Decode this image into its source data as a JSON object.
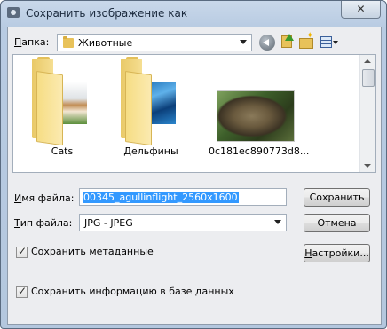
{
  "window": {
    "title": "Сохранить изображение как",
    "close": "✕"
  },
  "toolbar": {
    "folder_label": "Папка:",
    "folder_label_hotkey": "П",
    "folder_label_rest": "апка:",
    "folder_value": "Животные",
    "icons": [
      "back-icon",
      "up-folder-icon",
      "new-folder-icon",
      "view-menu-icon"
    ]
  },
  "files": [
    {
      "name": "Cats",
      "kind": "folder",
      "icon": "folder-icon"
    },
    {
      "name": "Дельфины",
      "kind": "folder",
      "icon": "folder-icon"
    },
    {
      "name": "0c181ec890773d8...",
      "kind": "image",
      "icon": "image-thumbnail"
    }
  ],
  "form": {
    "filename_label": "Имя файла:",
    "filename_label_hotkey": "И",
    "filename_label_rest": "мя файла:",
    "filename_value": "00345_agullinflight_2560x1600",
    "filetype_label": "Тип файла:",
    "filetype_label_hotkey": "Т",
    "filetype_label_rest": "ип файла:",
    "filetype_value": "JPG - JPEG",
    "save_button": "Сохранить",
    "cancel_button": "Отмена",
    "settings_button": "Настройки...",
    "settings_hotkey": "Н",
    "settings_rest": "астройки...",
    "save_metadata_label": "Сохранить метаданные",
    "save_metadata_checked": true,
    "save_db_label": "Сохранить информацию в базе данных",
    "save_db_checked": true
  }
}
